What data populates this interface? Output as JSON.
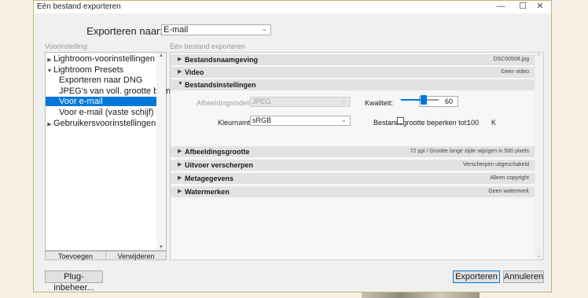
{
  "window": {
    "title": "Eén bestand exporteren",
    "minimize": "—",
    "maximize": "☐",
    "close": "✕"
  },
  "export_to": {
    "label": "Exporteren naar:",
    "value": "E-mail"
  },
  "presets": {
    "section_label": "Voorinstelling:",
    "items": [
      {
        "label": "Lightroom-voorinstellingen",
        "toggle": "▶"
      },
      {
        "label": "Lightroom Presets",
        "toggle": "▼"
      },
      {
        "label": "Exporteren naar DNG"
      },
      {
        "label": "JPEG's van voll. grootte branden"
      },
      {
        "label": "Voor e-mail"
      },
      {
        "label": "Voor e-mail (vaste schijf)"
      },
      {
        "label": "Gebruikersvoorinstellingen",
        "toggle": "▶"
      }
    ],
    "add_label": "Toevoegen",
    "remove_label": "Verwijderen"
  },
  "settings": {
    "section_label": "Eén bestand exporteren",
    "sections": [
      {
        "title": "Bestandsnaamgeving",
        "summary": "DSC00508.jpg",
        "toggle": "▶"
      },
      {
        "title": "Video",
        "summary": "Geen video",
        "toggle": "▶"
      },
      {
        "title": "Bestandsinstellingen",
        "summary": "",
        "toggle": "▼"
      },
      {
        "title": "Afbeeldingsgrootte",
        "summary": "72 ppi / Grootte lange zijde wijzigen in 500 pixels",
        "toggle": "▶"
      },
      {
        "title": "Uitvoer verscherpen",
        "summary": "Verscherpen uitgeschakeld",
        "toggle": "▶"
      },
      {
        "title": "Metagegevens",
        "summary": "Alleen copyright",
        "toggle": "▶"
      },
      {
        "title": "Watermerken",
        "summary": "Geen watermerk",
        "toggle": "▶"
      }
    ],
    "file_settings": {
      "format_label": "Afbeeldingsindeling:",
      "format_value": "JPEG",
      "quality_label": "Kwaliteit:",
      "quality_value": "60",
      "colorspace_label": "Kleurruimte:",
      "colorspace_value": "sRGB",
      "limit_label": "Bestandsgrootte beperken tot:",
      "limit_value": "100",
      "limit_unit": "K"
    }
  },
  "footer": {
    "plugin_label": "Plug-inbeheer...",
    "export_label": "Exporteren",
    "cancel_label": "Annuleren"
  }
}
